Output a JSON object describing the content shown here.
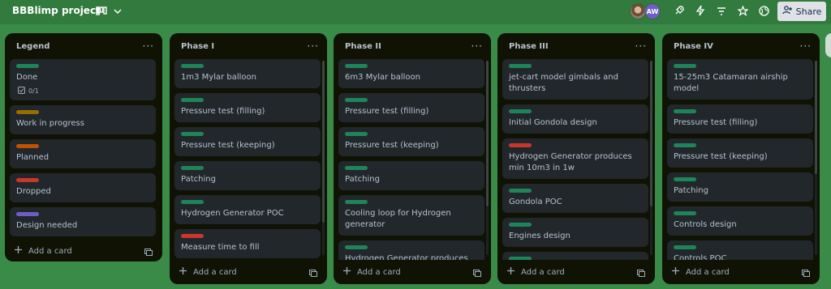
{
  "header": {
    "board_title": "BBBlimp project",
    "avatar_initials": "AW",
    "share_label": "Share"
  },
  "colors": {
    "green": "#1f845a",
    "yellow": "#946f00",
    "orange": "#c25100",
    "red": "#c9372c",
    "purple": "#6e5dc6"
  },
  "lists": [
    {
      "title": "Legend",
      "add_label": "Add a card",
      "cards": [
        {
          "label": "green",
          "title": "Done",
          "checklist": "0/1"
        },
        {
          "label": "yellow",
          "title": "Work in progress"
        },
        {
          "label": "orange",
          "title": "Planned"
        },
        {
          "label": "red",
          "title": "Dropped"
        },
        {
          "label": "purple",
          "title": "Design needed"
        }
      ]
    },
    {
      "title": "Phase I",
      "add_label": "Add a card",
      "cards": [
        {
          "label": "green",
          "title": "1m3 Mylar balloon"
        },
        {
          "label": "green",
          "title": "Pressure test (filling)"
        },
        {
          "label": "green",
          "title": "Pressure test (keeping)"
        },
        {
          "label": "green",
          "title": "Patching"
        },
        {
          "label": "green",
          "title": "Hydrogen Generator POC"
        },
        {
          "label": "red",
          "title": "Measure time to fill"
        },
        {
          "label": "green",
          "title": ""
        }
      ]
    },
    {
      "title": "Phase II",
      "add_label": "Add a card",
      "cards": [
        {
          "label": "green",
          "title": "6m3 Mylar balloon"
        },
        {
          "label": "green",
          "title": "Pressure test (filling)"
        },
        {
          "label": "green",
          "title": "Pressure test (keeping)"
        },
        {
          "label": "green",
          "title": "Patching"
        },
        {
          "label": "green",
          "title": "Cooling loop for Hydrogen generator"
        },
        {
          "label": "green",
          "title": "Hydrogen Generator produces"
        }
      ]
    },
    {
      "title": "Phase III",
      "add_label": "Add a card",
      "cards": [
        {
          "label": "green",
          "title": "jet-cart model gimbals and thrusters"
        },
        {
          "label": "green",
          "title": "Initial Gondola design"
        },
        {
          "label": "red",
          "title": "Hydrogen Generator produces min 10m3 in 1w"
        },
        {
          "label": "green",
          "title": "Gondola POC"
        },
        {
          "label": "green",
          "title": "Engines design"
        },
        {
          "label": "green",
          "title": ""
        }
      ]
    },
    {
      "title": "Phase IV",
      "add_label": "Add a card",
      "cards": [
        {
          "label": "green",
          "title": "15-25m3 Catamaran airship model"
        },
        {
          "label": "green",
          "title": "Pressure test (filling)"
        },
        {
          "label": "green",
          "title": "Pressure test (keeping)"
        },
        {
          "label": "green",
          "title": "Patching"
        },
        {
          "label": "green",
          "title": "Controls design"
        },
        {
          "label": "green",
          "title": "Controls POC"
        }
      ]
    }
  ]
}
